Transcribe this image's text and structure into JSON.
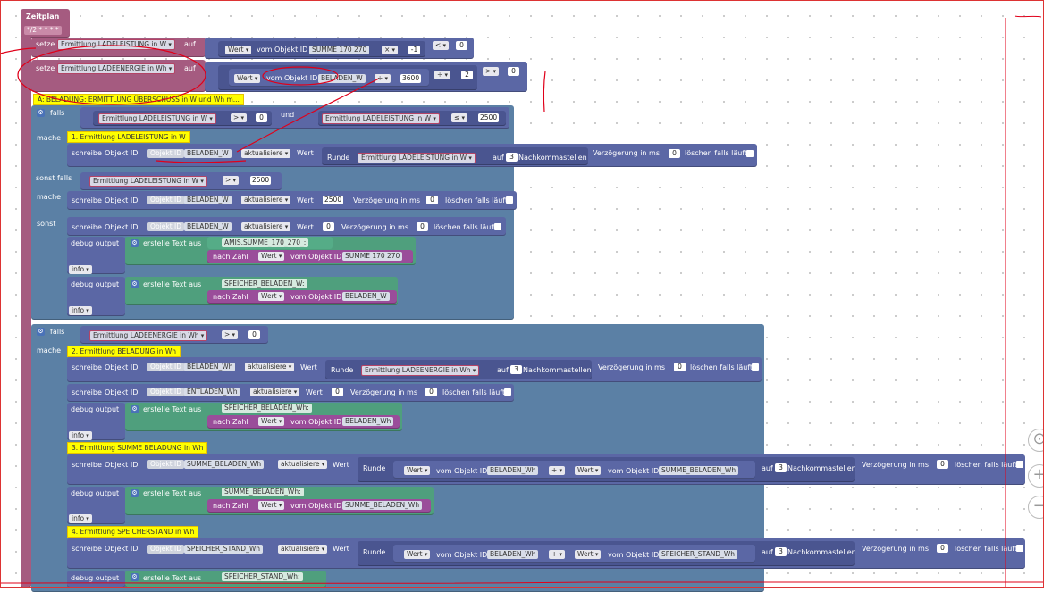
{
  "trigger": {
    "label": "Zeitplan",
    "cron": "*/2 * * * *"
  },
  "set1": {
    "setze": "setze",
    "var": "Ermittlung LADELEISTUNG in W",
    "auf": "auf",
    "wert": "Wert",
    "vom": "vom Objekt ID",
    "obj": "SUMME 170 270",
    "op": "×",
    "n": "-1",
    "cmp": "<",
    "cmpn": "0"
  },
  "set2": {
    "setze": "setze",
    "var": "Ermittlung LADEENERGIE in Wh",
    "auf": "auf",
    "wert": "Wert",
    "vom": "vom Objekt ID",
    "obj": "BELADEN_W",
    "op": "÷",
    "n": "3600",
    "op2": "÷",
    "n2": "2",
    "cmp": ">",
    "cmpn": "0"
  },
  "commentA": "A: BELADUNG: ERMITTLUNG ÜBERSCHUSS in W und Wh m...",
  "if1": {
    "falls": "falls",
    "var1": "Ermittlung LADELEISTUNG in W",
    "cmp1": ">",
    "n1": "0",
    "und": "und",
    "var2": "Ermittlung LADELEISTUNG in W",
    "cmp2": "≤",
    "n2": "2500"
  },
  "mache": "mache",
  "comment1": "1. Ermittlung LADELEISTUNG in W",
  "w1": {
    "schreibe": "schreibe",
    "objid": "Objekt ID",
    "objlabel": "Objekt ID",
    "obj": "BELADEN_W",
    "mode": "aktualisiere",
    "wert": "Wert",
    "runde": "Runde",
    "var": "Ermittlung LADELEISTUNG in W",
    "auf": "auf",
    "digits": "3",
    "nk": "Nachkommastellen",
    "delay": "Verzögerung in ms",
    "ms": "0",
    "del": "löschen falls läuft"
  },
  "elseif": {
    "label": "sonst falls",
    "var": "Ermittlung LADELEISTUNG in W",
    "cmp": ">",
    "n": "2500"
  },
  "w2": {
    "obj": "BELADEN_W",
    "val": "2500"
  },
  "sonst": "sonst",
  "w3": {
    "obj": "BELADEN_W",
    "val": "0"
  },
  "dbg1": {
    "label": "debug output",
    "erstelle": "erstelle Text aus",
    "text": "AMIS.SUMME_170_270_:",
    "nachzahl": "nach Zahl",
    "obj": "SUMME 170 270",
    "level": "info"
  },
  "dbg2": {
    "text": "SPEICHER_BELADEN_W:",
    "obj": "BELADEN_W",
    "level": "info"
  },
  "if2": {
    "falls": "falls",
    "var": "Ermittlung LADEENERGIE in Wh",
    "cmp": ">",
    "n": "0"
  },
  "comment2": "2. Ermittlung BELADUNG in Wh",
  "w4": {
    "obj": "BELADEN_Wh",
    "var": "Ermittlung LADEENERGIE in Wh"
  },
  "w5": {
    "obj": "ENTLADEN_Wh",
    "val": "0"
  },
  "dbg3": {
    "text": "SPEICHER_BELADEN_Wh:",
    "obj": "BELADEN_Wh",
    "level": "info"
  },
  "comment3": "3. Ermittlung SUMME BELADUNG in Wh",
  "w6": {
    "obj": "SUMME_BELADEN_Wh",
    "a": "BELADEN_Wh",
    "op": "+",
    "b": "SUMME_BELADEN_Wh"
  },
  "dbg4": {
    "text": "SUMME_BELADEN_Wh:",
    "obj": "SUMME_BELADEN_Wh",
    "level": "info"
  },
  "comment4": "4. Ermittlung SPEICHERSTAND in Wh",
  "w7": {
    "obj": "SPEICHER_STAND_Wh",
    "a": "BELADEN_Wh",
    "op": "+",
    "b": "SPEICHER_STAND_Wh"
  },
  "dbg5": {
    "text": "SPEICHER_STAND_Wh:"
  },
  "colors": {
    "annotation": "#e0001a",
    "purple": "#a55b80",
    "blue": "#5b67a5",
    "green": "#4f9f7d",
    "comment": "#ffff00"
  }
}
